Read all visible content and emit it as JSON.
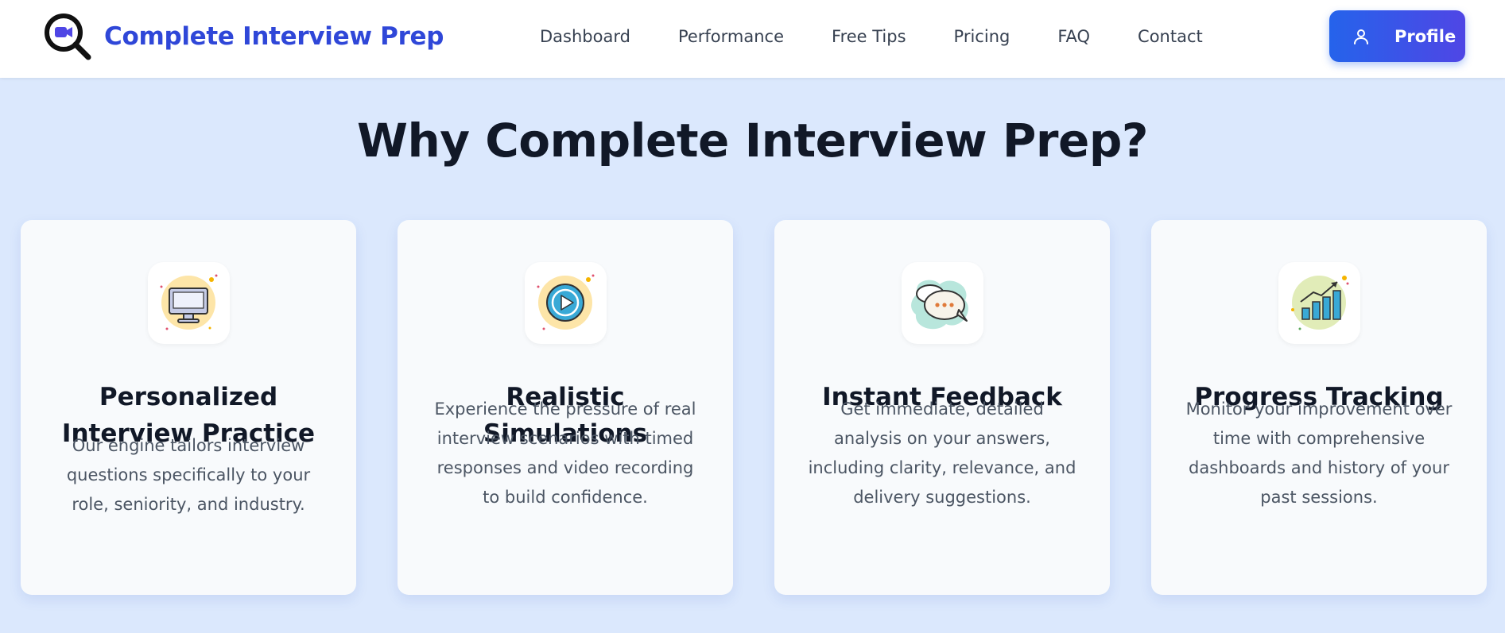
{
  "brand": {
    "name": "Complete Interview Prep",
    "icon": "magnifier-camera-icon"
  },
  "nav": {
    "links": [
      "Dashboard",
      "Performance",
      "Free Tips",
      "Pricing",
      "FAQ",
      "Contact"
    ],
    "profile_label": "Profile",
    "profile_icon": "user-icon"
  },
  "section": {
    "title": "Why Complete Interview Prep?"
  },
  "features": [
    {
      "icon": "monitor-icon",
      "title": "Personalized Interview Practice",
      "description": "Our engine tailors interview questions specifically to your role, seniority, and industry."
    },
    {
      "icon": "play-icon",
      "title": "Realistic Simulations",
      "description": "Experience the pressure of real interview scenarios with timed responses and video recording to build confidence."
    },
    {
      "icon": "chat-bubbles-icon",
      "title": "Instant Feedback",
      "description": "Get immediate, detailed analysis on your answers, including clarity, relevance, and delivery suggestions."
    },
    {
      "icon": "growth-chart-icon",
      "title": "Progress Tracking",
      "description": "Monitor your improvement over time with comprehensive dashboards and history of your past sessions."
    }
  ],
  "colors": {
    "brand": "#2f47d8",
    "page_background": "#dbe8fd",
    "button_gradient_start": "#2563eb",
    "button_gradient_end": "#4f46e5"
  }
}
